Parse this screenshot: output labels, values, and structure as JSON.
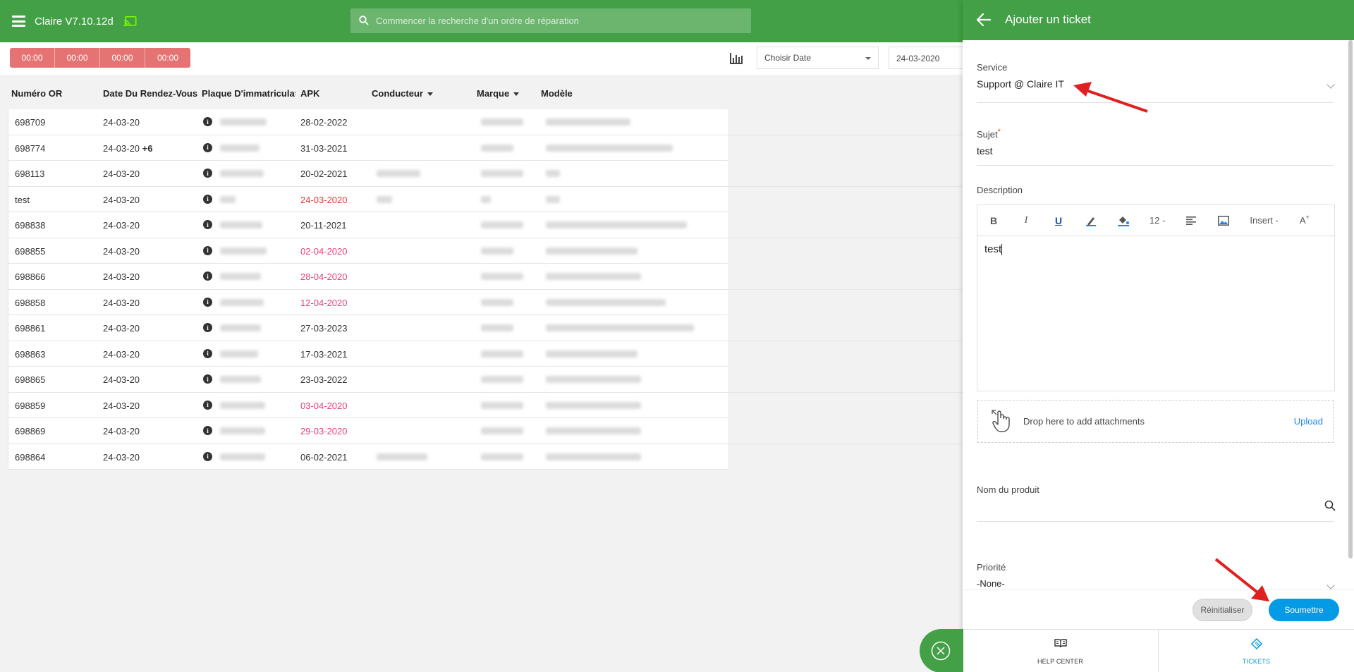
{
  "app": {
    "title": "Claire V7.10.12d",
    "search_placeholder": "Commencer la recherche d'un ordre de réparation"
  },
  "toolbar": {
    "timers": [
      "00:00",
      "00:00",
      "00:00",
      "00:00"
    ],
    "date_select": "Choisir Date",
    "date_value": "24-03-2020"
  },
  "table": {
    "headers": [
      "Numéro OR",
      "Date Du Rendez-Vous",
      "Plaque D'immatriculatio",
      "APK",
      "Conducteur",
      "Marque",
      "Modèle"
    ],
    "rows": [
      {
        "or": "698709",
        "date": "24-03-20",
        "extra": "",
        "apk": "28-02-2022",
        "apk_status": "normal"
      },
      {
        "or": "698774",
        "date": "24-03-20",
        "extra": "+6",
        "apk": "31-03-2021",
        "apk_status": "normal"
      },
      {
        "or": "698113",
        "date": "24-03-20",
        "extra": "",
        "apk": "20-02-2021",
        "apk_status": "normal"
      },
      {
        "or": "test",
        "date": "24-03-20",
        "extra": "",
        "apk": "24-03-2020",
        "apk_status": "red"
      },
      {
        "or": "698838",
        "date": "24-03-20",
        "extra": "",
        "apk": "20-11-2021",
        "apk_status": "normal"
      },
      {
        "or": "698855",
        "date": "24-03-20",
        "extra": "",
        "apk": "02-04-2020",
        "apk_status": "pink"
      },
      {
        "or": "698866",
        "date": "24-03-20",
        "extra": "",
        "apk": "28-04-2020",
        "apk_status": "pink"
      },
      {
        "or": "698858",
        "date": "24-03-20",
        "extra": "",
        "apk": "12-04-2020",
        "apk_status": "pink"
      },
      {
        "or": "698861",
        "date": "24-03-20",
        "extra": "",
        "apk": "27-03-2023",
        "apk_status": "normal"
      },
      {
        "or": "698863",
        "date": "24-03-20",
        "extra": "",
        "apk": "17-03-2021",
        "apk_status": "normal"
      },
      {
        "or": "698865",
        "date": "24-03-20",
        "extra": "",
        "apk": "23-03-2022",
        "apk_status": "normal"
      },
      {
        "or": "698859",
        "date": "24-03-20",
        "extra": "",
        "apk": "03-04-2020",
        "apk_status": "pink"
      },
      {
        "or": "698869",
        "date": "24-03-20",
        "extra": "",
        "apk": "29-03-2020",
        "apk_status": "pink"
      },
      {
        "or": "698864",
        "date": "24-03-20",
        "extra": "",
        "apk": "06-02-2021",
        "apk_status": "normal"
      }
    ]
  },
  "panel": {
    "title": "Ajouter un ticket",
    "service_label": "Service",
    "service_value": "Support @ Claire IT",
    "subject_label": "Sujet",
    "subject_required": "*",
    "subject_value": "test",
    "description_label": "Description",
    "editor_font_size": "12 -",
    "editor_insert": "Insert -",
    "description_value": "test",
    "attach_text": "Drop here to add attachments",
    "upload_label": "Upload",
    "product_label": "Nom du produit",
    "priority_label": "Priorité",
    "priority_value": "-None-",
    "reset_label": "Réinitialiser",
    "submit_label": "Soumettre",
    "tab_help": "HELP CENTER",
    "tab_tickets": "TICKETS"
  },
  "colors": {
    "brand_green": "#43a047",
    "timer_red": "#e57373",
    "apk_red": "#e53935",
    "apk_pink": "#ec407a",
    "submit_blue": "#039be5",
    "annotation_arrow": "#e02020"
  }
}
